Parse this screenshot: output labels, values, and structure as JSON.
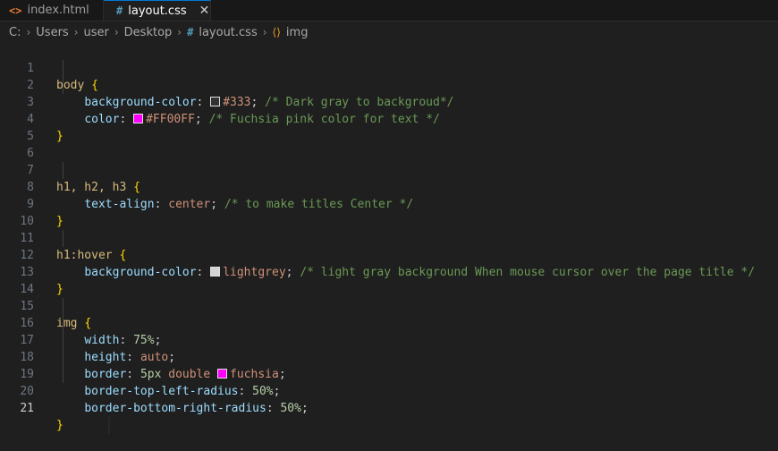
{
  "tabs": [
    {
      "label": "index.html",
      "icon": "html-file-icon",
      "active": false
    },
    {
      "label": "layout.css",
      "icon": "css-file-icon",
      "active": true
    }
  ],
  "breadcrumb": {
    "parts": [
      "C:",
      "Users",
      "user",
      "Desktop",
      "layout.css",
      "img"
    ]
  },
  "colors": {
    "c333": "#333333",
    "fuchsia": "#FF00FF",
    "lightgrey": "#d3d3d3"
  },
  "lines": {
    "n": [
      "1",
      "2",
      "3",
      "4",
      "5",
      "6",
      "7",
      "8",
      "9",
      "10",
      "11",
      "12",
      "13",
      "14",
      "15",
      "16",
      "17",
      "18",
      "19",
      "20",
      "21"
    ],
    "l1_sel": "body",
    "l2_prop": "background-color",
    "l2_val": "#333",
    "l2_com": "/* Dark gray to backgroud*/",
    "l3_prop": "color",
    "l3_val": "#FF00FF",
    "l3_com": "/* Fuchsia pink color for text */",
    "l7_sel": "h1, h2, h3",
    "l8_prop": "text-align",
    "l8_val": "center",
    "l8_com": "/* to make titles Center */",
    "l11_sel": "h1:hover",
    "l12_prop": "background-color",
    "l12_val": "lightgrey",
    "l12_com": "/* light gray background When mouse cursor over the page title */",
    "l15_sel": "img",
    "l16_prop": "width",
    "l16_val": "75%",
    "l17_prop": "height",
    "l17_val": "auto",
    "l18_prop": "border",
    "l18_v1": "5px",
    "l18_v2": "double",
    "l18_v3": "fuchsia",
    "l19_prop": "border-top-left-radius",
    "l19_val": "50%",
    "l20_prop": "border-bottom-right-radius",
    "l20_val": "50%"
  }
}
